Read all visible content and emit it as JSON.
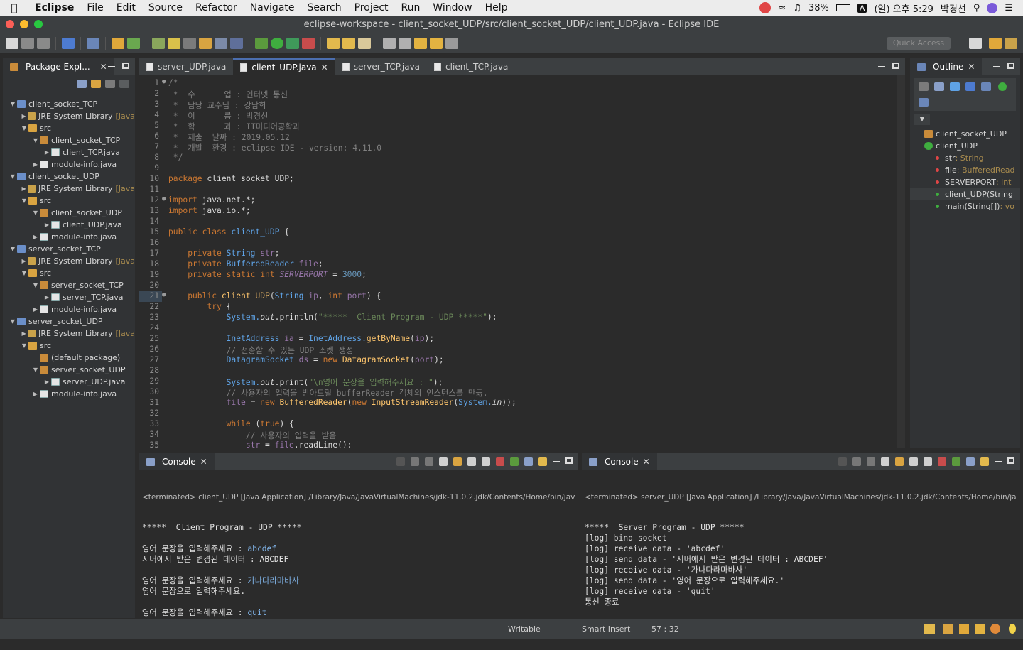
{
  "menubar": {
    "app_name": "Eclipse",
    "items": [
      "File",
      "Edit",
      "Source",
      "Refactor",
      "Navigate",
      "Search",
      "Project",
      "Run",
      "Window",
      "Help"
    ],
    "battery": "38%",
    "input": "A",
    "clock": "(일) 오후 5:29",
    "user": "박경선"
  },
  "window": {
    "title": "eclipse-workspace - client_socket_UDP/src/client_socket_UDP/client_UDP.java - Eclipse IDE"
  },
  "toolbar": {
    "quick_access": "Quick Access"
  },
  "package_explorer": {
    "title": "Package Expl...",
    "tree": [
      {
        "label": "client_socket_TCP",
        "depth": 0,
        "icon": "proj",
        "arrow": "down"
      },
      {
        "label": "JRE System Library",
        "suffix": "[Java",
        "depth": 1,
        "icon": "lib",
        "arrow": "right"
      },
      {
        "label": "src",
        "depth": 1,
        "icon": "src",
        "arrow": "down"
      },
      {
        "label": "client_socket_TCP",
        "depth": 2,
        "icon": "pkg",
        "arrow": "down"
      },
      {
        "label": "client_TCP.java",
        "depth": 3,
        "icon": "java",
        "arrow": "right"
      },
      {
        "label": "module-info.java",
        "depth": 2,
        "icon": "java",
        "arrow": "right"
      },
      {
        "label": "client_socket_UDP",
        "depth": 0,
        "icon": "proj",
        "arrow": "down"
      },
      {
        "label": "JRE System Library",
        "suffix": "[Java",
        "depth": 1,
        "icon": "lib",
        "arrow": "right"
      },
      {
        "label": "src",
        "depth": 1,
        "icon": "src",
        "arrow": "down"
      },
      {
        "label": "client_socket_UDP",
        "depth": 2,
        "icon": "pkg",
        "arrow": "down"
      },
      {
        "label": "client_UDP.java",
        "depth": 3,
        "icon": "java",
        "arrow": "right"
      },
      {
        "label": "module-info.java",
        "depth": 2,
        "icon": "java",
        "arrow": "right"
      },
      {
        "label": "server_socket_TCP",
        "depth": 0,
        "icon": "proj",
        "arrow": "down"
      },
      {
        "label": "JRE System Library",
        "suffix": "[Java",
        "depth": 1,
        "icon": "lib",
        "arrow": "right"
      },
      {
        "label": "src",
        "depth": 1,
        "icon": "src",
        "arrow": "down"
      },
      {
        "label": "server_socket_TCP",
        "depth": 2,
        "icon": "pkg",
        "arrow": "down"
      },
      {
        "label": "server_TCP.java",
        "depth": 3,
        "icon": "java",
        "arrow": "right"
      },
      {
        "label": "module-info.java",
        "depth": 2,
        "icon": "java",
        "arrow": "right"
      },
      {
        "label": "server_socket_UDP",
        "depth": 0,
        "icon": "proj",
        "arrow": "down"
      },
      {
        "label": "JRE System Library",
        "suffix": "[Java",
        "depth": 1,
        "icon": "lib",
        "arrow": "right"
      },
      {
        "label": "src",
        "depth": 1,
        "icon": "src",
        "arrow": "down"
      },
      {
        "label": "(default package)",
        "depth": 2,
        "icon": "pkg",
        "arrow": ""
      },
      {
        "label": "server_socket_UDP",
        "depth": 2,
        "icon": "pkg",
        "arrow": "down"
      },
      {
        "label": "server_UDP.java",
        "depth": 3,
        "icon": "java",
        "arrow": "right"
      },
      {
        "label": "module-info.java",
        "depth": 2,
        "icon": "java",
        "arrow": "right"
      }
    ]
  },
  "editor": {
    "tabs": [
      {
        "label": "server_UDP.java",
        "active": false
      },
      {
        "label": "client_UDP.java",
        "active": true
      },
      {
        "label": "server_TCP.java",
        "active": false
      },
      {
        "label": "client_TCP.java",
        "active": false
      }
    ],
    "current_line": 21,
    "lines": [
      {
        "n": 1,
        "fold": true,
        "segs": [
          [
            "cm",
            "/*"
          ]
        ]
      },
      {
        "n": 2,
        "segs": [
          [
            "cm",
            " *  수      업 : 인터넷 통신"
          ]
        ]
      },
      {
        "n": 3,
        "segs": [
          [
            "cm",
            " *  담당 교수님 : 강남희"
          ]
        ]
      },
      {
        "n": 4,
        "segs": [
          [
            "cm",
            " *  이      름 : 박경선"
          ]
        ]
      },
      {
        "n": 5,
        "segs": [
          [
            "cm",
            " *  학      과 : IT미디어공학과"
          ]
        ]
      },
      {
        "n": 6,
        "segs": [
          [
            "cm",
            " *  제출  날짜 : 2019.05.12"
          ]
        ]
      },
      {
        "n": 7,
        "segs": [
          [
            "cm",
            " *  개발  환경 : eclipse IDE - version: 4.11.0"
          ]
        ]
      },
      {
        "n": 8,
        "segs": [
          [
            "cm",
            " */"
          ]
        ]
      },
      {
        "n": 9,
        "segs": []
      },
      {
        "n": 10,
        "segs": [
          [
            "kw",
            "package "
          ],
          [
            "",
            "client_socket_UDP;"
          ]
        ]
      },
      {
        "n": 11,
        "segs": []
      },
      {
        "n": 12,
        "fold": true,
        "segs": [
          [
            "kw",
            "import "
          ],
          [
            "",
            "java.net.*;"
          ]
        ]
      },
      {
        "n": 13,
        "segs": [
          [
            "kw",
            "import "
          ],
          [
            "",
            "java.io.*;"
          ]
        ]
      },
      {
        "n": 14,
        "segs": []
      },
      {
        "n": 15,
        "segs": [
          [
            "kw",
            "public class "
          ],
          [
            "ty",
            "client_UDP"
          ],
          [
            "",
            " {"
          ]
        ]
      },
      {
        "n": 16,
        "segs": []
      },
      {
        "n": 17,
        "segs": [
          [
            "kw",
            "    private "
          ],
          [
            "ty",
            "String "
          ],
          [
            "fld",
            "str"
          ],
          [
            "",
            ";"
          ]
        ]
      },
      {
        "n": 18,
        "segs": [
          [
            "kw",
            "    private "
          ],
          [
            "ty",
            "BufferedReader "
          ],
          [
            "fld",
            "file"
          ],
          [
            "",
            ";"
          ]
        ]
      },
      {
        "n": 19,
        "segs": [
          [
            "kw",
            "    private static int "
          ],
          [
            "sf",
            "SERVERPORT"
          ],
          [
            "",
            " = "
          ],
          [
            "num",
            "3000"
          ],
          [
            "",
            ";"
          ]
        ]
      },
      {
        "n": 20,
        "segs": []
      },
      {
        "n": 21,
        "fold": true,
        "segs": [
          [
            "kw",
            "    public "
          ],
          [
            "fn",
            "client_UDP"
          ],
          [
            "",
            "("
          ],
          [
            "ty",
            "String "
          ],
          [
            "fld",
            "ip"
          ],
          [
            "",
            ", "
          ],
          [
            "kw",
            "int "
          ],
          [
            "fld",
            "port"
          ],
          [
            "",
            ") {"
          ]
        ]
      },
      {
        "n": 22,
        "segs": [
          [
            "kw",
            "        try "
          ],
          [
            "",
            "{"
          ]
        ]
      },
      {
        "n": 23,
        "segs": [
          [
            "ty",
            "            System."
          ],
          [
            "ita",
            "out"
          ],
          [
            "",
            ".println("
          ],
          [
            "st",
            "\"*****  Client Program - UDP *****\""
          ],
          [
            "",
            ");"
          ]
        ]
      },
      {
        "n": 24,
        "segs": []
      },
      {
        "n": 25,
        "segs": [
          [
            "ty",
            "            InetAddress "
          ],
          [
            "fld",
            "ia"
          ],
          [
            "",
            " = "
          ],
          [
            "ty",
            "InetAddress."
          ],
          [
            "fn",
            "getByName"
          ],
          [
            "",
            "("
          ],
          [
            "fld",
            "ip"
          ],
          [
            "",
            ");"
          ]
        ]
      },
      {
        "n": 26,
        "segs": [
          [
            "cm",
            "            // 전송할 수 있는 UDP 소켓 생성"
          ]
        ]
      },
      {
        "n": 27,
        "segs": [
          [
            "ty",
            "            DatagramSocket "
          ],
          [
            "fld",
            "ds"
          ],
          [
            "",
            " = "
          ],
          [
            "kw",
            "new "
          ],
          [
            "fn",
            "DatagramSocket"
          ],
          [
            "",
            "("
          ],
          [
            "fld",
            "port"
          ],
          [
            "",
            ");"
          ]
        ]
      },
      {
        "n": 28,
        "segs": []
      },
      {
        "n": 29,
        "segs": [
          [
            "ty",
            "            System."
          ],
          [
            "ita",
            "out"
          ],
          [
            "",
            ".print("
          ],
          [
            "st",
            "\"\\n영어 문장을 입력해주세요 : \""
          ],
          [
            "",
            ");"
          ]
        ]
      },
      {
        "n": 30,
        "segs": [
          [
            "cm",
            "            // 사용자의 입력을 받아드릴 bufferReader 객체의 인스턴스를 만듦."
          ]
        ]
      },
      {
        "n": 31,
        "segs": [
          [
            "fld",
            "            file"
          ],
          [
            "",
            " = "
          ],
          [
            "kw",
            "new "
          ],
          [
            "fn",
            "BufferedReader"
          ],
          [
            "",
            "("
          ],
          [
            "kw",
            "new "
          ],
          [
            "fn",
            "InputStreamReader"
          ],
          [
            "",
            "("
          ],
          [
            "ty",
            "System."
          ],
          [
            "ita",
            "in"
          ],
          [
            "",
            "));"
          ]
        ]
      },
      {
        "n": 32,
        "segs": []
      },
      {
        "n": 33,
        "segs": [
          [
            "kw",
            "            while "
          ],
          [
            "",
            "("
          ],
          [
            "kw",
            "true"
          ],
          [
            "",
            ") {"
          ]
        ]
      },
      {
        "n": 34,
        "segs": [
          [
            "cm",
            "                // 사용자의 입력을 받음"
          ]
        ]
      },
      {
        "n": 35,
        "segs": [
          [
            "fld",
            "                str"
          ],
          [
            "",
            " = "
          ],
          [
            "fld",
            "file"
          ],
          [
            "",
            ".readLine();"
          ]
        ]
      }
    ]
  },
  "outline": {
    "title": "Outline",
    "items": [
      {
        "label": "client_socket_UDP",
        "type": "",
        "depth": 0,
        "icon": "pkg"
      },
      {
        "label": "client_UDP",
        "type": "",
        "depth": 0,
        "icon": "class"
      },
      {
        "label": "str",
        "type": " : String",
        "depth": 1,
        "icon": "red"
      },
      {
        "label": "file",
        "type": " : BufferedRead",
        "depth": 1,
        "icon": "red"
      },
      {
        "label": "SERVERPORT",
        "type": " : int",
        "depth": 1,
        "icon": "red"
      },
      {
        "label": "client_UDP(String",
        "type": "",
        "depth": 1,
        "icon": "green"
      },
      {
        "label": "main(String[])",
        "type": " : vo",
        "depth": 1,
        "icon": "green"
      }
    ]
  },
  "console_left": {
    "title": "Console",
    "terminated": "<terminated> client_UDP [Java Application] /Library/Java/JavaVirtualMachines/jdk-11.0.2.jdk/Contents/Home/bin/jav",
    "lines": [
      {
        "t": "*****  Client Program - UDP *****"
      },
      {
        "t": ""
      },
      {
        "t": "영어 문장을 입력해주세요 : ",
        "i": "abcdef"
      },
      {
        "t": "서버에서 받은 변경된 데이터 : ABCDEF"
      },
      {
        "t": ""
      },
      {
        "t": "영어 문장을 입력해주세요 : ",
        "i": "가나다라마바사"
      },
      {
        "t": "영어 문장으로 입력해주세요."
      },
      {
        "t": ""
      },
      {
        "t": "영어 문장을 입력해주세요 : ",
        "i": "quit"
      },
      {
        "t": "통신 종료"
      }
    ]
  },
  "console_right": {
    "title": "Console",
    "terminated": "<terminated> server_UDP [Java Application] /Library/Java/JavaVirtualMachines/jdk-11.0.2.jdk/Contents/Home/bin/ja",
    "lines": [
      {
        "t": "*****  Server Program - UDP *****"
      },
      {
        "t": "[log] bind socket"
      },
      {
        "t": "[log] receive data - 'abcdef'"
      },
      {
        "t": "[log] send data - '서버에서 받은 변경된 데이터 : ABCDEF'"
      },
      {
        "t": "[log] receive data - '가나다라마바사'"
      },
      {
        "t": "[log] send data - '영어 문장으로 입력해주세요.'"
      },
      {
        "t": "[log] receive data - 'quit'"
      },
      {
        "t": "통신 종료"
      }
    ]
  },
  "statusbar": {
    "writable": "Writable",
    "insert": "Smart Insert",
    "position": "57 : 32"
  }
}
